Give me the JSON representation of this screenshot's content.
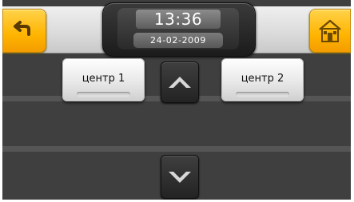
{
  "clock": {
    "time": "13:36",
    "date": "24-02-2009"
  },
  "rooms": [
    {
      "label": "центр 1"
    },
    {
      "label": "центр 2"
    }
  ],
  "icons": {
    "back": "back-arrow-icon",
    "home": "home-icon",
    "up": "chevron-up-icon",
    "down": "chevron-down-icon"
  },
  "colors": {
    "accent": "#ffb400",
    "background": "#3f3f3f"
  }
}
